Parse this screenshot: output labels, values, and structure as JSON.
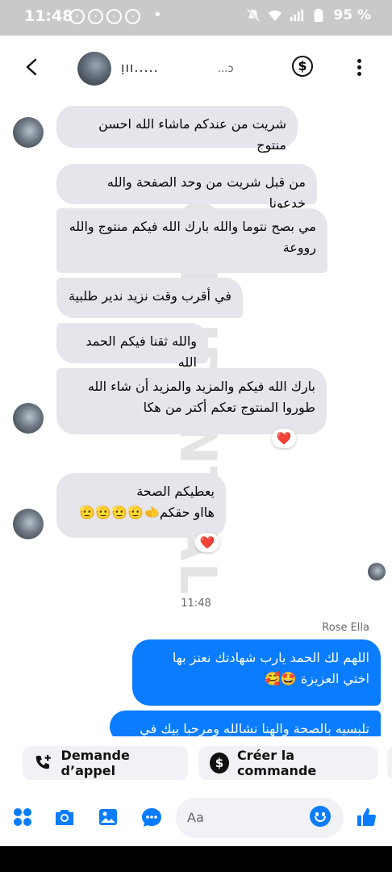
{
  "status_bar": {
    "time": "11:48",
    "battery": "95 %",
    "icons": [
      "notification-icon",
      "notification-icon",
      "notification-icon",
      "notification-icon",
      "mute-icon",
      "wifi-icon",
      "signal-icon",
      "battery-icon"
    ]
  },
  "header": {
    "contact_name": "ı̣ıı.....",
    "contact_name_suffix": "...ɔ",
    "icons": [
      "back-icon",
      "dollar-icon",
      "more-icon"
    ]
  },
  "watermark": "CONFIDENTIAL",
  "incoming_messages": [
    {
      "text": "شريت من عندكم ماشاء الله احسن منتوج"
    },
    {
      "text": "من قبل شريت من وحد الصفحة والله خدعونا"
    },
    {
      "text": "مي بصح نتوما والله بارك الله فيكم منتوج والله رووعة"
    },
    {
      "text": "في أقرب وقت نزيد ندير طلبية"
    },
    {
      "text": "والله ثقنا فيكم الحمد الله"
    },
    {
      "text": "بارك الله فيكم والمزيد والمزيد  أن شاء الله طوروا المنتوج تعكم أكتر من هكا",
      "reaction": "❤️"
    },
    {
      "text_line1": "يعطيكم الصحة",
      "text_line2": "هااو حقكم🫲🫡🫡🫡🫡",
      "reaction": "❤️"
    }
  ],
  "divider": {
    "timestamp": "11:48",
    "sender": "Rose Ella"
  },
  "outgoing_messages": [
    {
      "text": "اللهم لك الحمد يارب  شهادتك نعتز بها اختي العزيزة 🤩🥰"
    },
    {
      "text": "تلبسيه بالصحة والهنا نشالله ومرحبا بيك في كل"
    }
  ],
  "quick_actions": [
    {
      "label": "Demande d’appel",
      "icon": "phone-plus-icon"
    },
    {
      "label": "Créer la commande",
      "icon": "dollar-icon"
    }
  ],
  "composer": {
    "placeholder": "Aa",
    "icons": [
      "apps-icon",
      "camera-icon",
      "gallery-icon",
      "chat-bubble-icon",
      "emoji-icon",
      "like-icon"
    ]
  },
  "colors": {
    "accent": "#0a7cff",
    "incoming_bubble": "#e4e6eb",
    "status_bar": "#c9c9c9"
  }
}
